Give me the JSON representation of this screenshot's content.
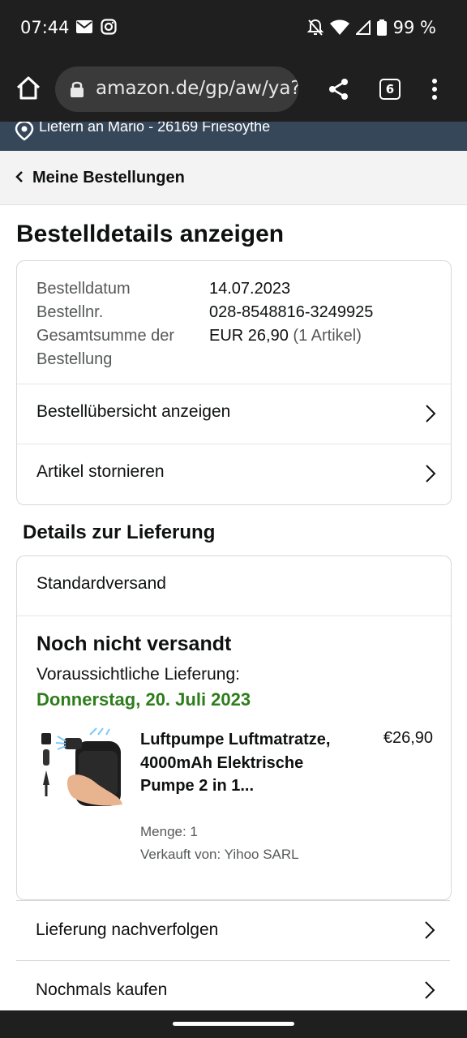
{
  "status": {
    "time": "07:44",
    "battery": "99 %"
  },
  "browser": {
    "url": "amazon.de/gp/aw/ya?",
    "tab_count": "6"
  },
  "delivery_bar": {
    "text": "Liefern an Mario - 26169 Friesoythe"
  },
  "back": {
    "label": "Meine Bestellungen"
  },
  "page": {
    "title": "Bestelldetails anzeigen"
  },
  "order": {
    "date_label": "Bestelldatum",
    "date_value": "14.07.2023",
    "number_label": "Bestellnr.",
    "number_value": "028-8548816-3249925",
    "total_label": "Gesamtsumme der Bestellung",
    "total_value": "EUR 26,90",
    "total_count": "(1 Artikel)",
    "links": [
      {
        "label": "Bestellübersicht anzeigen"
      },
      {
        "label": "Artikel stornieren"
      }
    ]
  },
  "delivery": {
    "section_title": "Details zur Lieferung",
    "method": "Standardversand",
    "status": "Noch nicht versandt",
    "eta_label": "Voraussichtliche Lieferung:",
    "eta_date": "Donnerstag, 20. Juli 2023",
    "product": {
      "title": "Luftpumpe Luftmatratze, 4000mAh Elektrische Pumpe 2 in 1...",
      "price": "€26,90",
      "quantity": "Menge: 1",
      "seller": "Verkauft von: Yihoo SARL"
    }
  },
  "bottom_links": [
    {
      "label": "Lieferung nachverfolgen"
    },
    {
      "label": "Nochmals kaufen"
    }
  ],
  "colors": {
    "eta_green": "#2e7d1c",
    "delivery_bar_bg": "#37475a",
    "system_bar_bg": "#1f1f1f"
  }
}
